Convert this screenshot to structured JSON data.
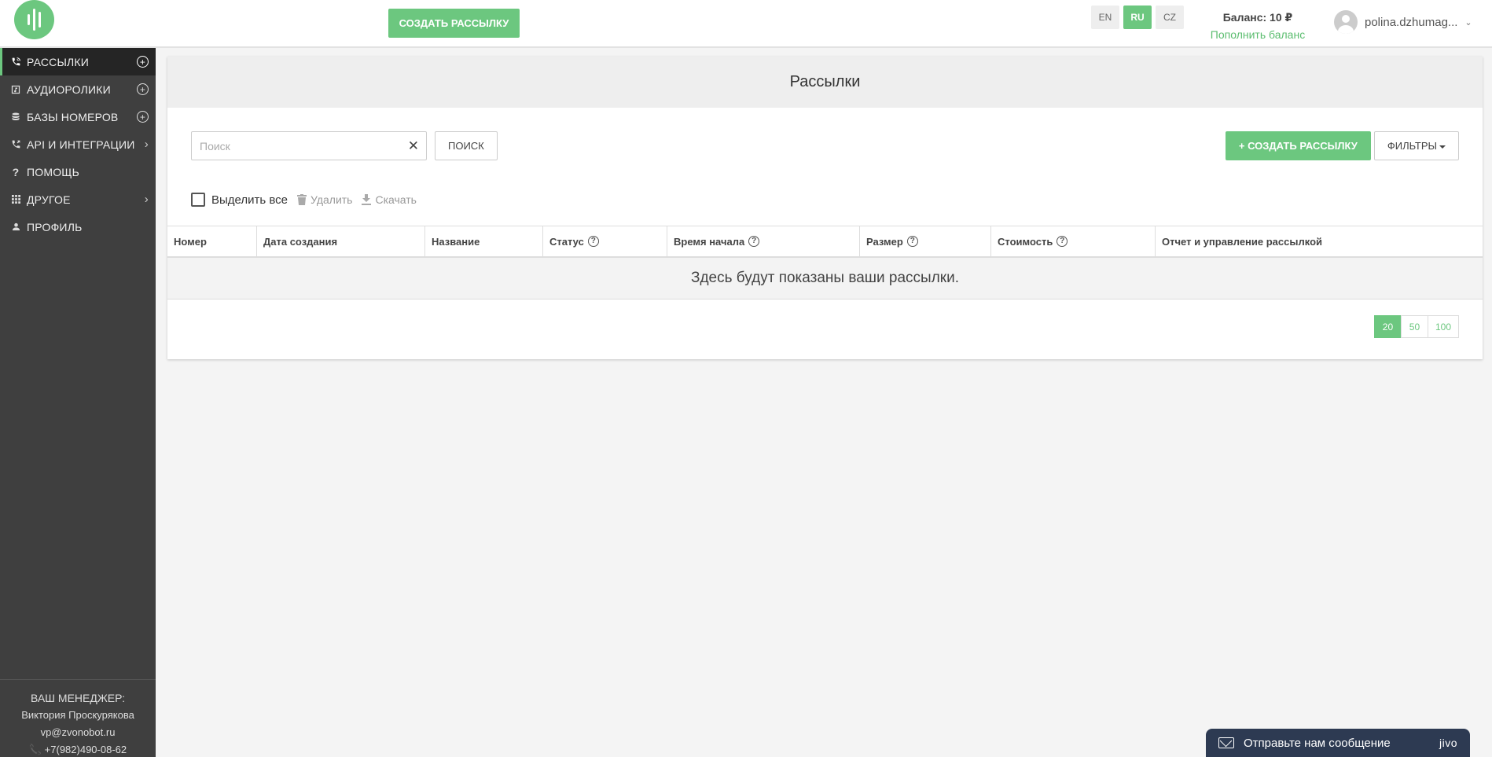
{
  "header": {
    "create_button": "СОЗДАТЬ РАССЫЛКУ",
    "languages": [
      {
        "code": "EN",
        "active": false
      },
      {
        "code": "RU",
        "active": true
      },
      {
        "code": "CZ",
        "active": false
      }
    ],
    "balance_label": "Баланс: 10 ₽",
    "topup_link": "Пополнить баланс",
    "user_name": "polina.dzhumag..."
  },
  "sidebar": {
    "items": [
      {
        "label": "РАССЫЛКИ",
        "icon": "phone-wave-icon",
        "action": "plus",
        "active": true
      },
      {
        "label": "АУДИОРОЛИКИ",
        "icon": "audio-file-icon",
        "action": "plus",
        "active": false
      },
      {
        "label": "БАЗЫ НОМЕРОВ",
        "icon": "database-icon",
        "action": "plus",
        "active": false
      },
      {
        "label": "API И ИНТЕГРАЦИИ",
        "icon": "phone-forward-icon",
        "action": "chevron",
        "active": false
      },
      {
        "label": "ПОМОЩЬ",
        "icon": "question-icon",
        "action": "none",
        "active": false
      },
      {
        "label": "ДРУГОЕ",
        "icon": "grid-icon",
        "action": "chevron",
        "active": false
      },
      {
        "label": "ПРОФИЛЬ",
        "icon": "person-icon",
        "action": "none",
        "active": false
      }
    ],
    "manager": {
      "title": "ВАШ МЕНЕДЖЕР:",
      "name": "Виктория Проскурякова",
      "email": "vp@zvonobot.ru",
      "phone": "+7(982)490-08-62"
    }
  },
  "main": {
    "title": "Рассылки",
    "search_placeholder": "Поиск",
    "search_value": "",
    "search_button": "ПОИСК",
    "create_button": "+ СОЗДАТЬ РАССЫЛКУ",
    "filters_button": "ФИЛЬТРЫ",
    "select_all": "Выделить все",
    "delete": "Удалить",
    "download": "Скачать",
    "columns": [
      {
        "label": "Номер",
        "help": false
      },
      {
        "label": "Дата создания",
        "help": false
      },
      {
        "label": "Название",
        "help": false
      },
      {
        "label": "Статус",
        "help": true
      },
      {
        "label": "Время начала",
        "help": true
      },
      {
        "label": "Размер",
        "help": true
      },
      {
        "label": "Стоимость",
        "help": true
      },
      {
        "label": "Отчет и управление рассылкой",
        "help": false
      }
    ],
    "empty_message": "Здесь будут показаны ваши рассылки.",
    "page_sizes": [
      {
        "value": "20",
        "active": true
      },
      {
        "value": "50",
        "active": false
      },
      {
        "value": "100",
        "active": false
      }
    ]
  },
  "chat": {
    "text": "Отправьте нам сообщение",
    "brand": "jivo"
  },
  "colors": {
    "accent": "#6cc77f",
    "sidebar_bg": "#3f3f3f",
    "sidebar_active": "#252525",
    "chat_bg": "#2d3a52"
  }
}
